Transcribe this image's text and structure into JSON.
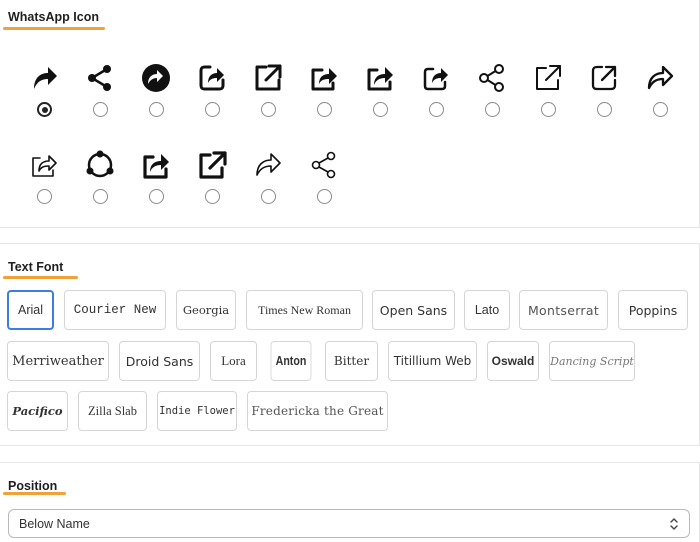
{
  "icon_section": {
    "title": "WhatsApp Icon",
    "icons": [
      {
        "name": "share-arrow-bold-icon",
        "selected": true
      },
      {
        "name": "share-nodes-icon",
        "selected": false
      },
      {
        "name": "share-circle-icon",
        "selected": false
      },
      {
        "name": "share-square-rounded-icon",
        "selected": false
      },
      {
        "name": "external-link-square-bold-icon",
        "selected": false
      },
      {
        "name": "share-box-arrow-icon",
        "selected": false
      },
      {
        "name": "share-box-arrow-alt-icon",
        "selected": false
      },
      {
        "name": "share-box-rounded-arrow-icon",
        "selected": false
      },
      {
        "name": "share-nodes-outline-icon",
        "selected": false
      },
      {
        "name": "external-link-thin-icon",
        "selected": false
      },
      {
        "name": "external-link-rounded-icon",
        "selected": false
      },
      {
        "name": "share-arrow-outline-icon",
        "selected": false
      },
      {
        "name": "share-box-thin-icon",
        "selected": false
      },
      {
        "name": "share-circle-nodes-icon",
        "selected": false
      },
      {
        "name": "share-box-bold-icon",
        "selected": false
      },
      {
        "name": "external-link-square-icon",
        "selected": false
      },
      {
        "name": "share-arrow-thin-icon",
        "selected": false
      },
      {
        "name": "share-nodes-thin-icon",
        "selected": false
      }
    ]
  },
  "font_section": {
    "title": "Text Font",
    "selected": "Arial",
    "fonts": [
      "Arial",
      "Courier New",
      "Georgia",
      "Times New Roman",
      "Open Sans",
      "Lato",
      "Montserrat",
      "Poppins",
      "Merriweather",
      "Droid Sans",
      "Lora",
      "Anton",
      "Bitter",
      "Titillium Web",
      "Oswald",
      "Dancing Script",
      "Pacifico",
      "Zilla Slab",
      "Indie Flower",
      "Fredericka the Great"
    ]
  },
  "position_section": {
    "title": "Position",
    "value": "Below Name"
  }
}
